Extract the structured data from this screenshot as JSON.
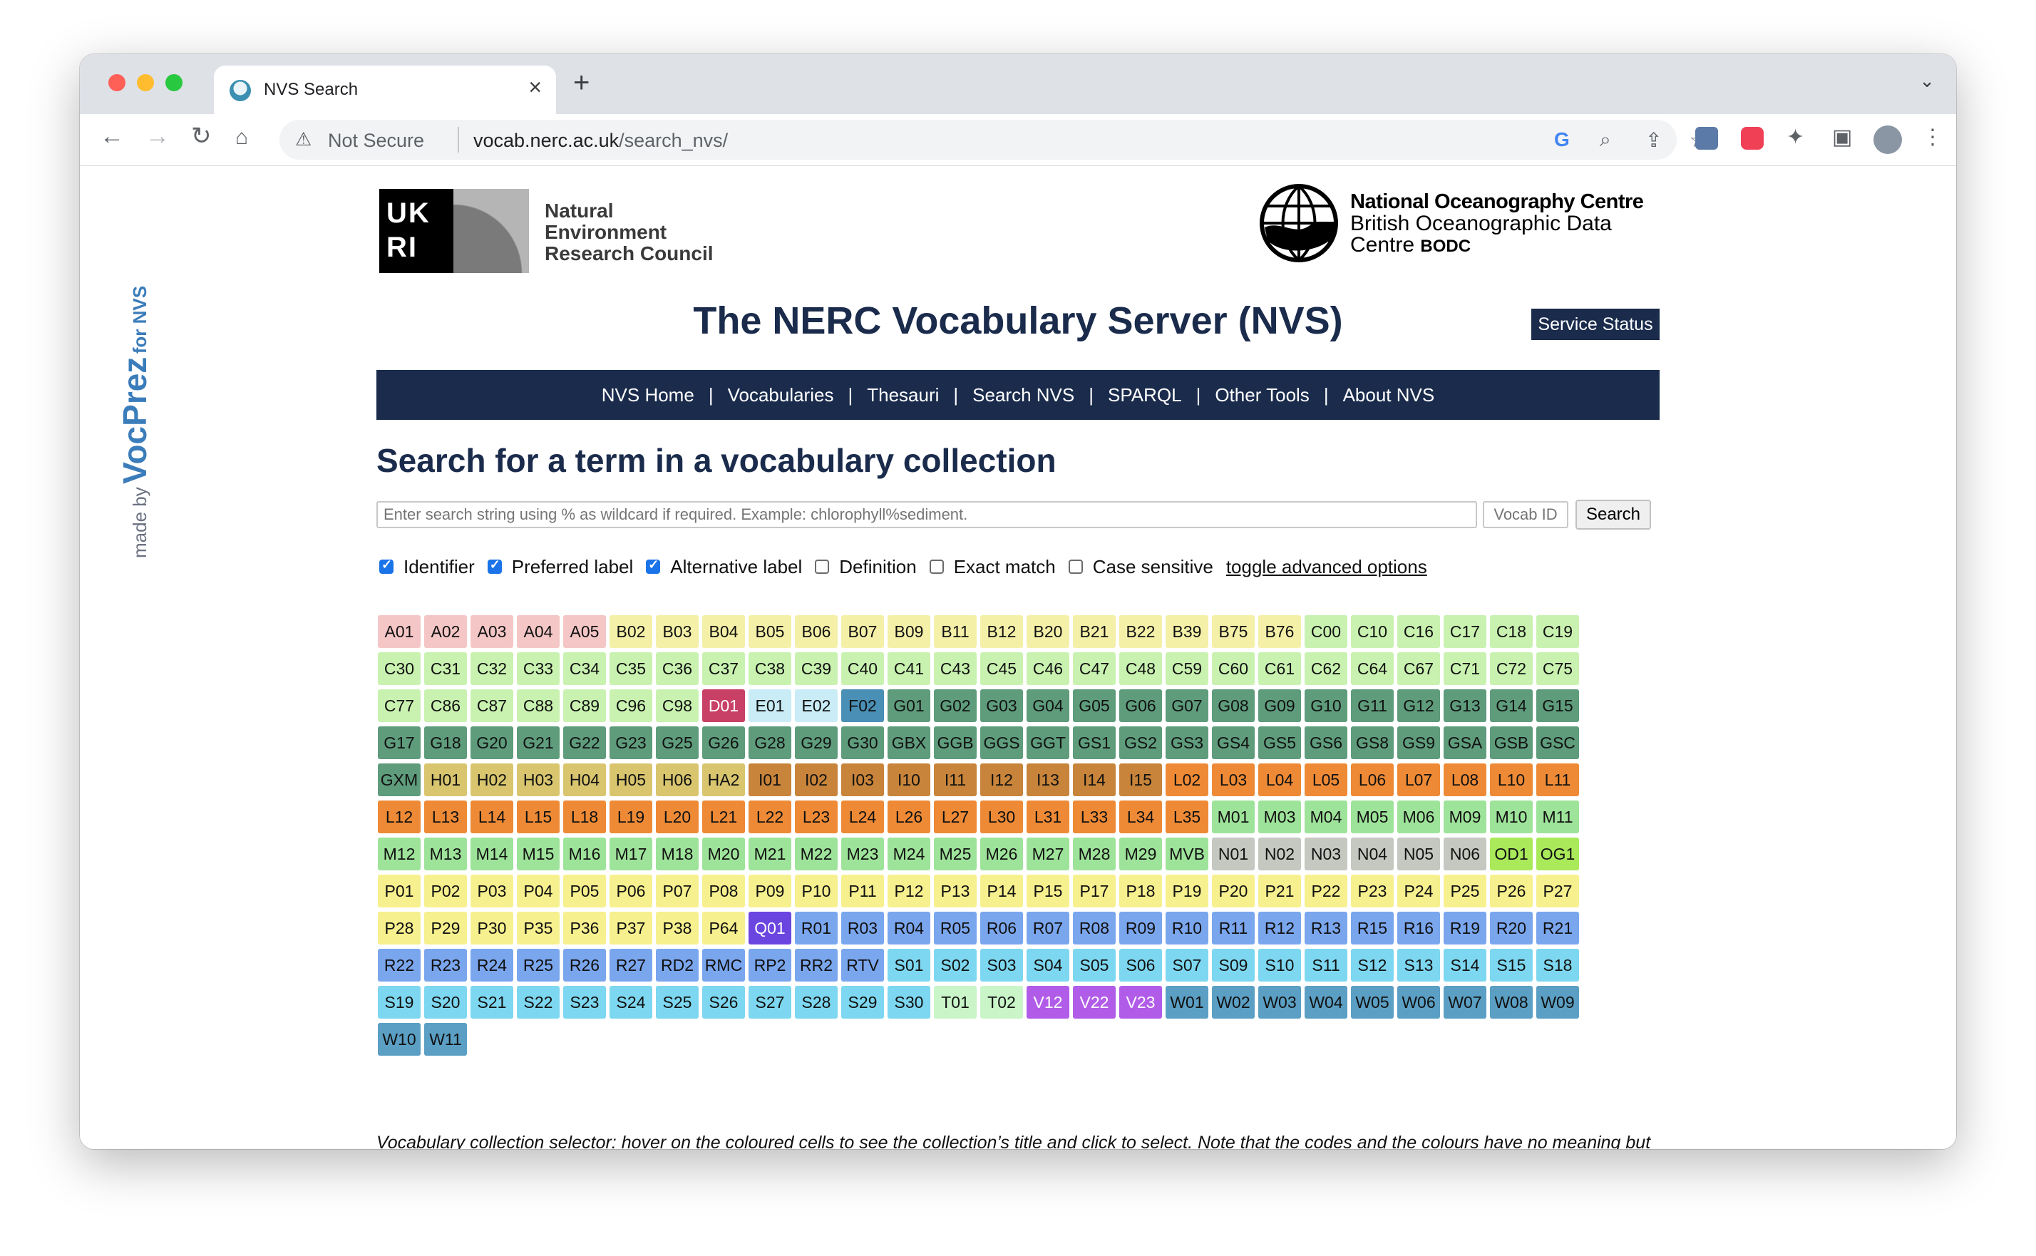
{
  "browser": {
    "tab_title": "NVS Search",
    "security_label": "Not Secure",
    "url_host": "vocab.nerc.ac.uk",
    "url_path": "/search_nvs/"
  },
  "sidebar": {
    "made_by": "made by",
    "brand": "VocPrez",
    "for": "for NVS"
  },
  "header": {
    "ukri_logo_text": "UK RI",
    "nerc_line1": "Natural",
    "nerc_line2": "Environment",
    "nerc_line3": "Research Council",
    "noc_name": "National Oceanography Centre",
    "noc_sub1": "British Oceanographic Data",
    "noc_sub2": "Centre",
    "noc_bodc": "BODC",
    "site_title": "The NERC Vocabulary Server (NVS)",
    "service_status": "Service Status"
  },
  "nav": [
    "NVS Home",
    "Vocabularies",
    "Thesauri",
    "Search NVS",
    "SPARQL",
    "Other Tools",
    "About NVS"
  ],
  "search": {
    "heading": "Search for a term in a vocabulary collection",
    "placeholder": "Enter search string using % as wildcard if required. Example: chlorophyll%sediment.",
    "vocab_placeholder": "Vocab ID",
    "button": "Search",
    "options": [
      {
        "label": "Identifier",
        "checked": true
      },
      {
        "label": "Preferred label",
        "checked": true
      },
      {
        "label": "Alternative label",
        "checked": true
      },
      {
        "label": "Definition",
        "checked": false
      },
      {
        "label": "Exact match",
        "checked": false
      },
      {
        "label": "Case sensitive",
        "checked": false
      }
    ],
    "toggle_label": "toggle advanced options"
  },
  "colors": {
    "A": "#f5c6c6",
    "B": "#f5f0a8",
    "C": "#c9f2b0",
    "D": "#c94066",
    "E": "#c9ecf7",
    "F": "#4a8fb5",
    "G": "#5e9c7c",
    "H": "#d8c56e",
    "I": "#c8843a",
    "L": "#ee8a36",
    "M": "#9ee39a",
    "N": "#c4c8c0",
    "O": "#a9e95a",
    "P": "#f7f08e",
    "Q": "#6b45e0",
    "R": "#7aa6ee",
    "S": "#7dd7f0",
    "T": "#c9f5c9",
    "V": "#b15ce8",
    "W": "#5b9fc4"
  },
  "vocab_rows": [
    [
      "A01",
      "A02",
      "A03",
      "A04",
      "A05",
      "B02",
      "B03",
      "B04",
      "B05",
      "B06",
      "B07",
      "B09",
      "B11",
      "B12",
      "B20",
      "B21",
      "B22",
      "B39",
      "B75",
      "B76",
      "C00",
      "C10",
      "C16",
      "C17",
      "C18",
      "C19"
    ],
    [
      "C30",
      "C31",
      "C32",
      "C33",
      "C34",
      "C35",
      "C36",
      "C37",
      "C38",
      "C39",
      "C40",
      "C41",
      "C43",
      "C45",
      "C46",
      "C47",
      "C48",
      "C59",
      "C60",
      "C61",
      "C62",
      "C64",
      "C67",
      "C71",
      "C72",
      "C75"
    ],
    [
      "C77",
      "C86",
      "C87",
      "C88",
      "C89",
      "C96",
      "C98",
      "D01",
      "E01",
      "E02",
      "F02",
      "G01",
      "G02",
      "G03",
      "G04",
      "G05",
      "G06",
      "G07",
      "G08",
      "G09",
      "G10",
      "G11",
      "G12",
      "G13",
      "G14",
      "G15"
    ],
    [
      "G17",
      "G18",
      "G20",
      "G21",
      "G22",
      "G23",
      "G25",
      "G26",
      "G28",
      "G29",
      "G30",
      "GBX",
      "GGB",
      "GGS",
      "GGT",
      "GS1",
      "GS2",
      "GS3",
      "GS4",
      "GS5",
      "GS6",
      "GS8",
      "GS9",
      "GSA",
      "GSB",
      "GSC"
    ],
    [
      "GXM",
      "H01",
      "H02",
      "H03",
      "H04",
      "H05",
      "H06",
      "HA2",
      "I01",
      "I02",
      "I03",
      "I10",
      "I11",
      "I12",
      "I13",
      "I14",
      "I15",
      "L02",
      "L03",
      "L04",
      "L05",
      "L06",
      "L07",
      "L08",
      "L10",
      "L11"
    ],
    [
      "L12",
      "L13",
      "L14",
      "L15",
      "L18",
      "L19",
      "L20",
      "L21",
      "L22",
      "L23",
      "L24",
      "L26",
      "L27",
      "L30",
      "L31",
      "L33",
      "L34",
      "L35",
      "M01",
      "M03",
      "M04",
      "M05",
      "M06",
      "M09",
      "M10",
      "M11"
    ],
    [
      "M12",
      "M13",
      "M14",
      "M15",
      "M16",
      "M17",
      "M18",
      "M20",
      "M21",
      "M22",
      "M23",
      "M24",
      "M25",
      "M26",
      "M27",
      "M28",
      "M29",
      "MVB",
      "N01",
      "N02",
      "N03",
      "N04",
      "N05",
      "N06",
      "OD1",
      "OG1"
    ],
    [
      "P01",
      "P02",
      "P03",
      "P04",
      "P05",
      "P06",
      "P07",
      "P08",
      "P09",
      "P10",
      "P11",
      "P12",
      "P13",
      "P14",
      "P15",
      "P17",
      "P18",
      "P19",
      "P20",
      "P21",
      "P22",
      "P23",
      "P24",
      "P25",
      "P26",
      "P27"
    ],
    [
      "P28",
      "P29",
      "P30",
      "P35",
      "P36",
      "P37",
      "P38",
      "P64",
      "Q01",
      "R01",
      "R03",
      "R04",
      "R05",
      "R06",
      "R07",
      "R08",
      "R09",
      "R10",
      "R11",
      "R12",
      "R13",
      "R15",
      "R16",
      "R19",
      "R20",
      "R21"
    ],
    [
      "R22",
      "R23",
      "R24",
      "R25",
      "R26",
      "R27",
      "RD2",
      "RMC",
      "RP2",
      "RR2",
      "RTV",
      "S01",
      "S02",
      "S03",
      "S04",
      "S05",
      "S06",
      "S07",
      "S09",
      "S10",
      "S11",
      "S12",
      "S13",
      "S14",
      "S15",
      "S18"
    ],
    [
      "S19",
      "S20",
      "S21",
      "S22",
      "S23",
      "S24",
      "S25",
      "S26",
      "S27",
      "S28",
      "S29",
      "S30",
      "T01",
      "T02",
      "V12",
      "V22",
      "V23",
      "W01",
      "W02",
      "W03",
      "W04",
      "W05",
      "W06",
      "W07",
      "W08",
      "W09"
    ],
    [
      "W10",
      "W11"
    ]
  ],
  "caption": "Vocabulary collection selector: hover on the coloured cells to see the collection’s title and click to select. Note that the codes and the colours have no meaning but related vocabularies tend to be given a code starting with the same letter."
}
